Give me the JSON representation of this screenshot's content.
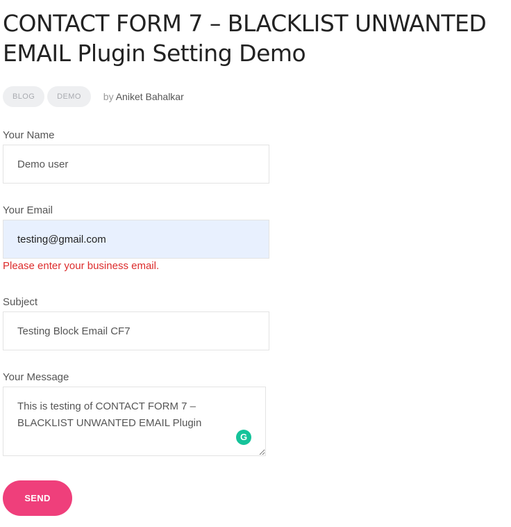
{
  "post": {
    "title": "CONTACT FORM 7 – BLACKLIST UNWANTED EMAIL Plugin Setting Demo",
    "tags": [
      "BLOG",
      "DEMO"
    ],
    "by_prefix": "by",
    "author": "Aniket Bahalkar"
  },
  "form": {
    "name": {
      "label": "Your Name",
      "value": "Demo user"
    },
    "email": {
      "label": "Your Email",
      "value": "testing@gmail.com",
      "error": "Please enter your business email."
    },
    "subject": {
      "label": "Subject",
      "value": "Testing Block Email CF7"
    },
    "message": {
      "label": "Your Message",
      "value": "This is testing of CONTACT FORM 7 – BLACKLIST UNWANTED EMAIL Plugin"
    },
    "send_label": "SEND"
  },
  "icons": {
    "grammarly": "grammarly-icon"
  },
  "colors": {
    "accent": "#ef3f7b",
    "error": "#dc2b2b",
    "autofill": "#e8f0fe",
    "grammarly": "#15c39a"
  }
}
